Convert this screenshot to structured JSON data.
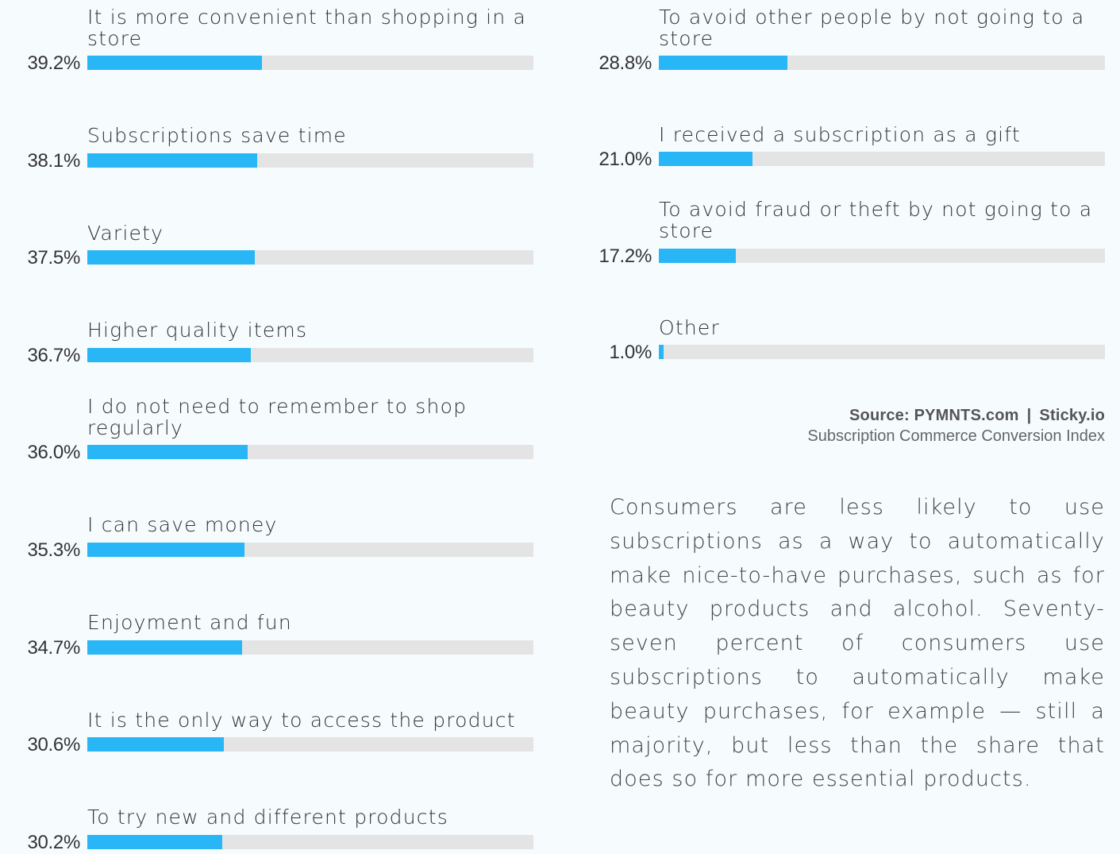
{
  "chart_data": {
    "type": "bar",
    "orientation": "horizontal",
    "value_format": "percent",
    "xlim": [
      0,
      100
    ],
    "categories": [
      "It is more convenient than shopping in a store",
      "Subscriptions save time",
      "Variety",
      "Higher quality items",
      "I do not need to remember to shop regularly",
      "I can save money",
      "Enjoyment and fun",
      "It is the only way to access the product",
      "To try new and different products",
      "To avoid other people by not going to a store",
      "I received a subscription as a gift",
      "To avoid fraud or theft by not going to a store",
      "Other"
    ],
    "values": [
      39.2,
      38.1,
      37.5,
      36.7,
      36.0,
      35.3,
      34.7,
      30.6,
      30.2,
      28.8,
      21.0,
      17.2,
      1.0
    ],
    "value_labels": [
      "39.2%",
      "38.1%",
      "37.5%",
      "36.7%",
      "36.0%",
      "35.3%",
      "34.7%",
      "30.6%",
      "30.2%",
      "28.8%",
      "21.0%",
      "17.2%",
      "1.0%"
    ],
    "colors": {
      "bar": "#29b6f6",
      "track": "#e4e4e4"
    }
  },
  "source": {
    "label": "Source: PYMNTS.com",
    "separator": "|",
    "partner": "Sticky.io",
    "report": "Subscription Commerce Conversion Index"
  },
  "paragraph": "Consumers are less likely to use subscriptions as a way to automatically make nice-to-have purchases, such as for beauty products and alcohol. Seventy-seven percent of consumers use subscriptions to automatically make beauty purchases, for example — still a majority, but less than the share that does so for more essential products."
}
